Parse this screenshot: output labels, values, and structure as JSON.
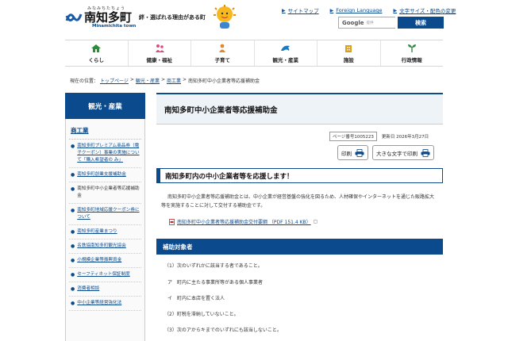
{
  "header": {
    "logo_ruby": "みなみちたちょう",
    "logo_name": "南知多町",
    "logo_roman": "Minamichita town",
    "tagline": "絆・選ばれる理由がある町",
    "links": [
      "サイトマップ",
      "Foreign Language",
      "文字サイズ・配色の変更"
    ],
    "search_google": "Google",
    "search_sub": "提供",
    "search_button": "検索"
  },
  "gnav": {
    "items": [
      {
        "label": "くらし",
        "icon": "house-icon",
        "color": "#2e8b3a"
      },
      {
        "label": "健康・福祉",
        "icon": "care-icon",
        "color": "#d94f7a"
      },
      {
        "label": "子育て",
        "icon": "child-icon",
        "color": "#e0892a"
      },
      {
        "label": "観光・産業",
        "icon": "dolphin-icon",
        "color": "#1a7ac0"
      },
      {
        "label": "施設",
        "icon": "building-icon",
        "color": "#d9a21a"
      },
      {
        "label": "行政情報",
        "icon": "leaf-icon",
        "color": "#2e8b3a"
      }
    ]
  },
  "breadcrumb": {
    "prefix": "現在の位置：",
    "items": [
      "トップページ",
      "観光・産業",
      "商工業"
    ],
    "current": "南知多町中小企業者等応援補助金",
    "sep": ">"
  },
  "sidebar": {
    "heading": "観光・産業",
    "category": "商工業",
    "items": [
      "南知多町プレミアム商品券（電子クーポン）事業の実施について「購入希望者の み」",
      "南知多町創業支援補助金",
      "南知多町中小企業者等応援補助金",
      "南知多町地域応援クーポン券について",
      "南知多町産業まつり",
      "名鉄協南知多町観光協会",
      "小規模企業等振興資金",
      "セーフティネット保証制度",
      "消費者相談",
      "中小企業等経営強化法"
    ]
  },
  "main": {
    "title": "南知多町中小企業者等応援補助金",
    "page_no": "ページ番号1005223",
    "updated": "更新日 2026年3月27日",
    "print_label": "印刷",
    "big_print_label": "大きな文字で印刷",
    "section1_title": "南知多町内の中小企業者等を応援します！",
    "intro": "南知多町中小企業者等応援補助金とは、中小企業が経営基盤の強化を図るため、人材確保やインターネットを通じた販路拡大等を実施することに対して交付する補助金です。",
    "pdf_link": "南知多町中小企業者等応援補助金交付要綱 （PDF 151.4 KB）",
    "section2_title": "補助対象者",
    "conditions": [
      "（1）次のいずれかに該当する者であること。",
      "ア　町内に主たる事業所等がある個人事業者",
      "イ　町内に本店を置く法人",
      "（2）町税を滞納していないこと。",
      "（3）次のアからキまでのいずれにも該当しないこと。"
    ]
  },
  "colors": {
    "brand": "#0b4a8c",
    "link": "#0b4a8c"
  }
}
